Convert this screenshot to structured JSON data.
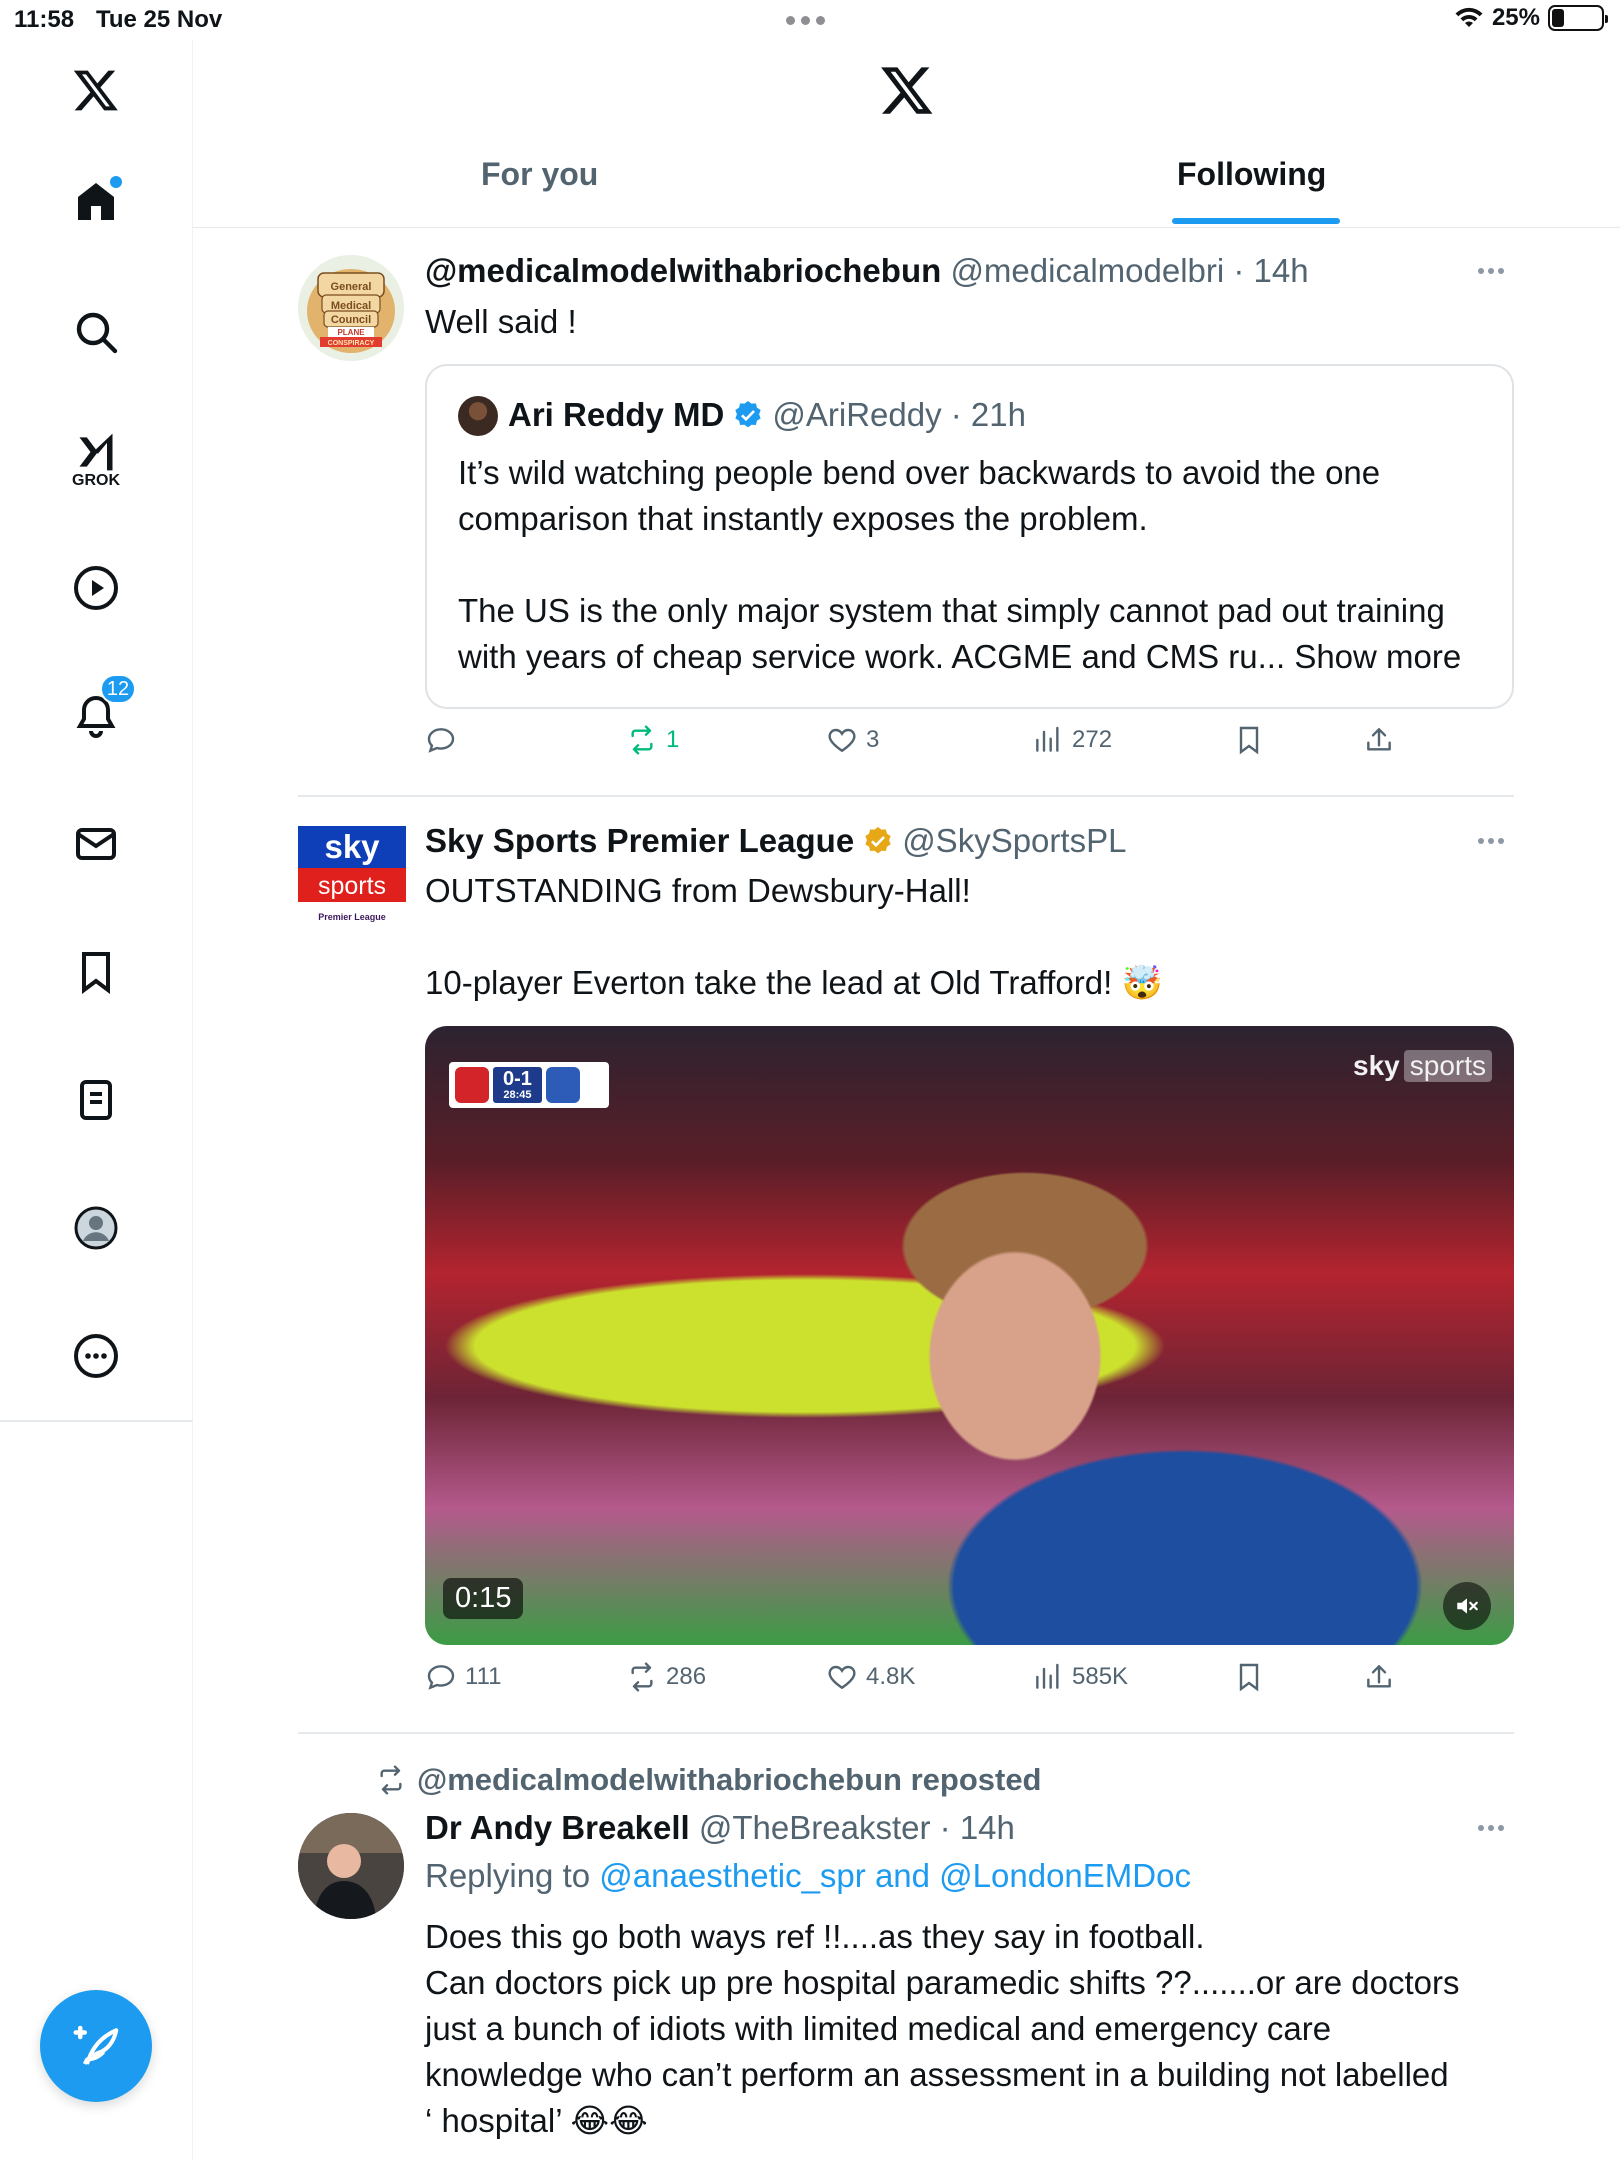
{
  "status_bar": {
    "time": "11:58",
    "date": "Tue 25 Nov",
    "battery": "25%",
    "battery_level": 0.25
  },
  "sidebar": {
    "items": [
      {
        "name": "home",
        "has_dot": true
      },
      {
        "name": "search"
      },
      {
        "name": "grok",
        "label": "GROK"
      },
      {
        "name": "video"
      },
      {
        "name": "notifications",
        "badge": "12"
      },
      {
        "name": "messages"
      },
      {
        "name": "bookmarks"
      },
      {
        "name": "lists"
      },
      {
        "name": "profile"
      },
      {
        "name": "more"
      }
    ],
    "compose_icon": "compose-icon"
  },
  "header": {
    "tabs": [
      {
        "label": "For you",
        "active": false
      },
      {
        "label": "Following",
        "active": true
      }
    ]
  },
  "colors": {
    "accent": "#1d9bf0",
    "text": "#0f1419",
    "muted": "#536471",
    "repost_green": "#00ba7c",
    "gold_verified": "#e6a817"
  },
  "tweets": [
    {
      "name": "@medicalmodelwithabriochebun",
      "handle": "@medicalmodelbri",
      "time": "14h",
      "text": "Well said !",
      "quote": {
        "name": "Ari Reddy MD",
        "handle": "@AriReddy",
        "time": "21h",
        "para1": "It’s wild watching people bend over backwards to avoid the one comparison that instantly exposes the problem.",
        "para2": "The US is the only major system that simply cannot pad out training with years of cheap service work. ACGME and CMS ru...",
        "show_more": "Show more"
      },
      "stats": {
        "replies": "",
        "reposts": "1",
        "likes": "3",
        "views": "272"
      }
    },
    {
      "name": "Sky Sports Premier League",
      "handle": "@SkySportsPL",
      "text1": "OUTSTANDING from Dewsbury-Hall!",
      "text2": "10-player Everton take the lead at Old Trafford! 🤯",
      "media": {
        "score": "0-1",
        "clock": "28:45",
        "brand_sky": "sky",
        "brand_sports": "sports",
        "duration": "0:15"
      },
      "stats": {
        "replies": "111",
        "reposts": "286",
        "likes": "4.8K",
        "views": "585K"
      }
    },
    {
      "repost_label": "@medicalmodelwithabriochebun reposted",
      "name": "Dr Andy Breakell",
      "handle": "@TheBreakster",
      "time": "14h",
      "replying_prefix": "Replying to",
      "replying_1": "@anaesthetic_spr",
      "replying_and": "and",
      "replying_2": "@LondonEMDoc",
      "text_l1": "Does this go both ways ref !!....as they say in football.",
      "text_l2": "Can doctors pick up pre hospital paramedic shifts ??.......or are doctors",
      "text_l3": "just a bunch of idiots with limited medical and emergency care",
      "text_l4": "knowledge who can’t perform an assessment in a building not labelled",
      "text_l5": "‘ hospital’ 😂😂"
    }
  ],
  "avatars": {
    "medical": {
      "line1": "General",
      "line2": "Medical",
      "line3": "Council",
      "line4": "PLANE",
      "line5": "CONSPIRACY"
    },
    "sky": {
      "line1": "sky",
      "line2": "sports",
      "line3": "Premier League"
    }
  }
}
